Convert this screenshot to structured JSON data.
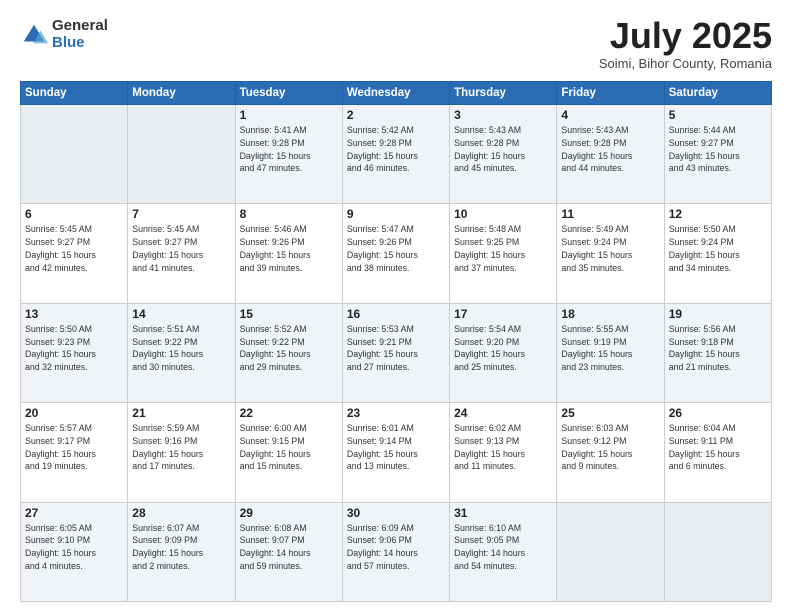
{
  "header": {
    "logo_general": "General",
    "logo_blue": "Blue",
    "month_title": "July 2025",
    "location": "Soimi, Bihor County, Romania"
  },
  "weekdays": [
    "Sunday",
    "Monday",
    "Tuesday",
    "Wednesday",
    "Thursday",
    "Friday",
    "Saturday"
  ],
  "rows": [
    [
      {
        "day": "",
        "text": "",
        "empty": true
      },
      {
        "day": "",
        "text": "",
        "empty": true
      },
      {
        "day": "1",
        "text": "Sunrise: 5:41 AM\nSunset: 9:28 PM\nDaylight: 15 hours\nand 47 minutes."
      },
      {
        "day": "2",
        "text": "Sunrise: 5:42 AM\nSunset: 9:28 PM\nDaylight: 15 hours\nand 46 minutes."
      },
      {
        "day": "3",
        "text": "Sunrise: 5:43 AM\nSunset: 9:28 PM\nDaylight: 15 hours\nand 45 minutes."
      },
      {
        "day": "4",
        "text": "Sunrise: 5:43 AM\nSunset: 9:28 PM\nDaylight: 15 hours\nand 44 minutes."
      },
      {
        "day": "5",
        "text": "Sunrise: 5:44 AM\nSunset: 9:27 PM\nDaylight: 15 hours\nand 43 minutes."
      }
    ],
    [
      {
        "day": "6",
        "text": "Sunrise: 5:45 AM\nSunset: 9:27 PM\nDaylight: 15 hours\nand 42 minutes."
      },
      {
        "day": "7",
        "text": "Sunrise: 5:45 AM\nSunset: 9:27 PM\nDaylight: 15 hours\nand 41 minutes."
      },
      {
        "day": "8",
        "text": "Sunrise: 5:46 AM\nSunset: 9:26 PM\nDaylight: 15 hours\nand 39 minutes."
      },
      {
        "day": "9",
        "text": "Sunrise: 5:47 AM\nSunset: 9:26 PM\nDaylight: 15 hours\nand 38 minutes."
      },
      {
        "day": "10",
        "text": "Sunrise: 5:48 AM\nSunset: 9:25 PM\nDaylight: 15 hours\nand 37 minutes."
      },
      {
        "day": "11",
        "text": "Sunrise: 5:49 AM\nSunset: 9:24 PM\nDaylight: 15 hours\nand 35 minutes."
      },
      {
        "day": "12",
        "text": "Sunrise: 5:50 AM\nSunset: 9:24 PM\nDaylight: 15 hours\nand 34 minutes."
      }
    ],
    [
      {
        "day": "13",
        "text": "Sunrise: 5:50 AM\nSunset: 9:23 PM\nDaylight: 15 hours\nand 32 minutes."
      },
      {
        "day": "14",
        "text": "Sunrise: 5:51 AM\nSunset: 9:22 PM\nDaylight: 15 hours\nand 30 minutes."
      },
      {
        "day": "15",
        "text": "Sunrise: 5:52 AM\nSunset: 9:22 PM\nDaylight: 15 hours\nand 29 minutes."
      },
      {
        "day": "16",
        "text": "Sunrise: 5:53 AM\nSunset: 9:21 PM\nDaylight: 15 hours\nand 27 minutes."
      },
      {
        "day": "17",
        "text": "Sunrise: 5:54 AM\nSunset: 9:20 PM\nDaylight: 15 hours\nand 25 minutes."
      },
      {
        "day": "18",
        "text": "Sunrise: 5:55 AM\nSunset: 9:19 PM\nDaylight: 15 hours\nand 23 minutes."
      },
      {
        "day": "19",
        "text": "Sunrise: 5:56 AM\nSunset: 9:18 PM\nDaylight: 15 hours\nand 21 minutes."
      }
    ],
    [
      {
        "day": "20",
        "text": "Sunrise: 5:57 AM\nSunset: 9:17 PM\nDaylight: 15 hours\nand 19 minutes."
      },
      {
        "day": "21",
        "text": "Sunrise: 5:59 AM\nSunset: 9:16 PM\nDaylight: 15 hours\nand 17 minutes."
      },
      {
        "day": "22",
        "text": "Sunrise: 6:00 AM\nSunset: 9:15 PM\nDaylight: 15 hours\nand 15 minutes."
      },
      {
        "day": "23",
        "text": "Sunrise: 6:01 AM\nSunset: 9:14 PM\nDaylight: 15 hours\nand 13 minutes."
      },
      {
        "day": "24",
        "text": "Sunrise: 6:02 AM\nSunset: 9:13 PM\nDaylight: 15 hours\nand 11 minutes."
      },
      {
        "day": "25",
        "text": "Sunrise: 6:03 AM\nSunset: 9:12 PM\nDaylight: 15 hours\nand 9 minutes."
      },
      {
        "day": "26",
        "text": "Sunrise: 6:04 AM\nSunset: 9:11 PM\nDaylight: 15 hours\nand 6 minutes."
      }
    ],
    [
      {
        "day": "27",
        "text": "Sunrise: 6:05 AM\nSunset: 9:10 PM\nDaylight: 15 hours\nand 4 minutes."
      },
      {
        "day": "28",
        "text": "Sunrise: 6:07 AM\nSunset: 9:09 PM\nDaylight: 15 hours\nand 2 minutes."
      },
      {
        "day": "29",
        "text": "Sunrise: 6:08 AM\nSunset: 9:07 PM\nDaylight: 14 hours\nand 59 minutes."
      },
      {
        "day": "30",
        "text": "Sunrise: 6:09 AM\nSunset: 9:06 PM\nDaylight: 14 hours\nand 57 minutes."
      },
      {
        "day": "31",
        "text": "Sunrise: 6:10 AM\nSunset: 9:05 PM\nDaylight: 14 hours\nand 54 minutes."
      },
      {
        "day": "",
        "text": "",
        "empty": true
      },
      {
        "day": "",
        "text": "",
        "empty": true
      }
    ]
  ]
}
